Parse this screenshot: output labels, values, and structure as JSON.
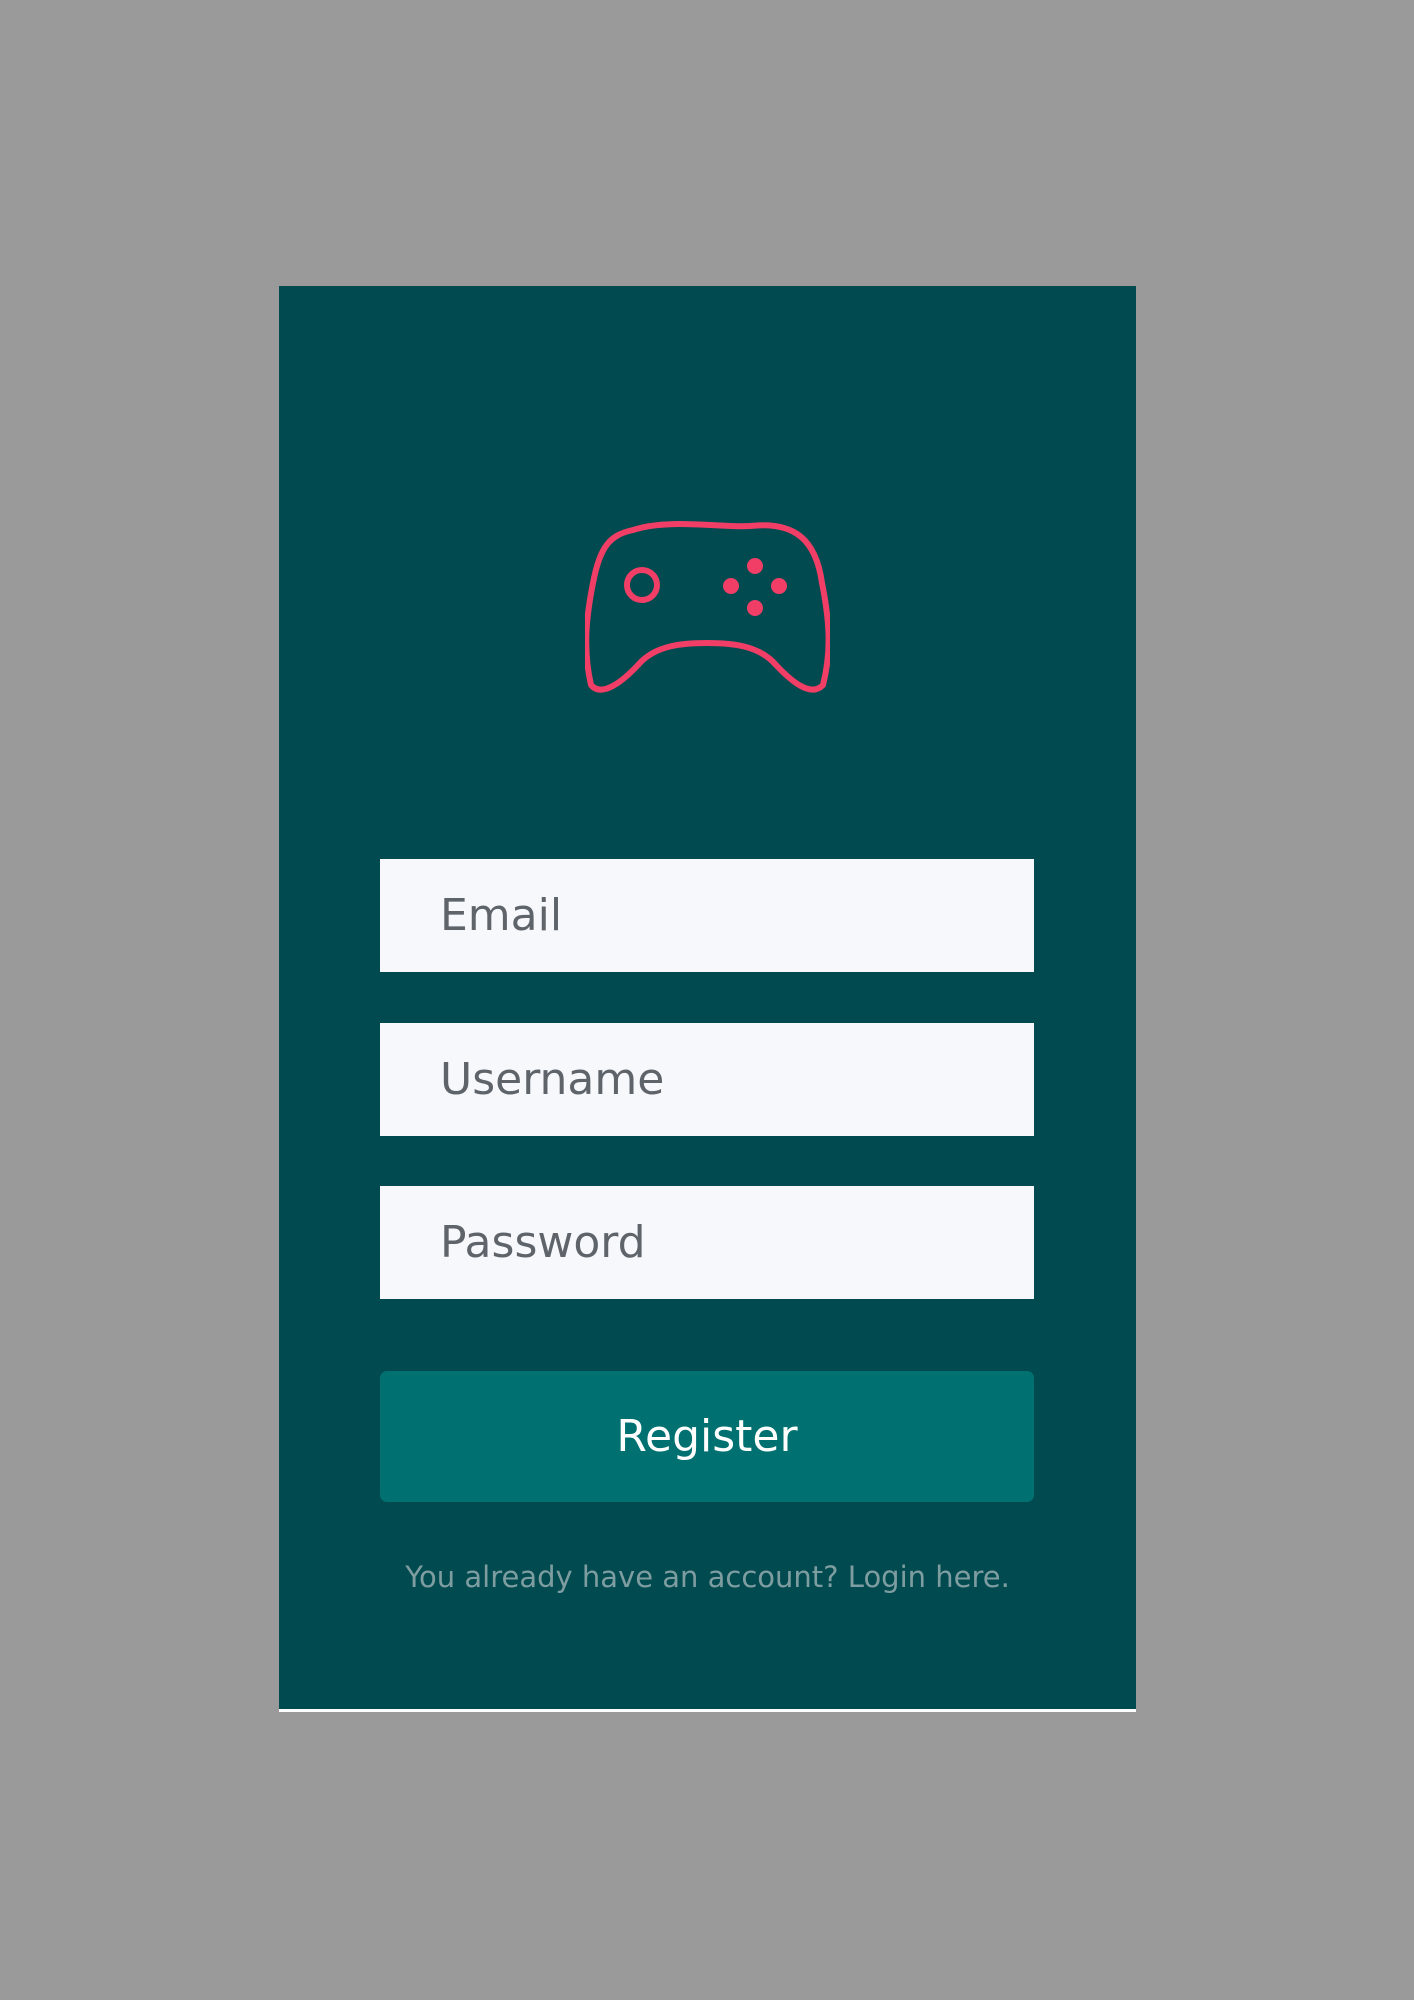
{
  "form": {
    "email_placeholder": "Email",
    "username_placeholder": "Username",
    "password_placeholder": "Password",
    "register_label": "Register",
    "login_text": "You already have an account? Login here."
  },
  "icons": {
    "logo": "gamepad-icon"
  },
  "colors": {
    "background": "#9a9a9a",
    "card": "#004a50",
    "accent": "#f03e66",
    "button": "#007170",
    "input_background": "#f6f8fc",
    "input_text": "#5f646b",
    "link_text": "#7e9da0"
  }
}
